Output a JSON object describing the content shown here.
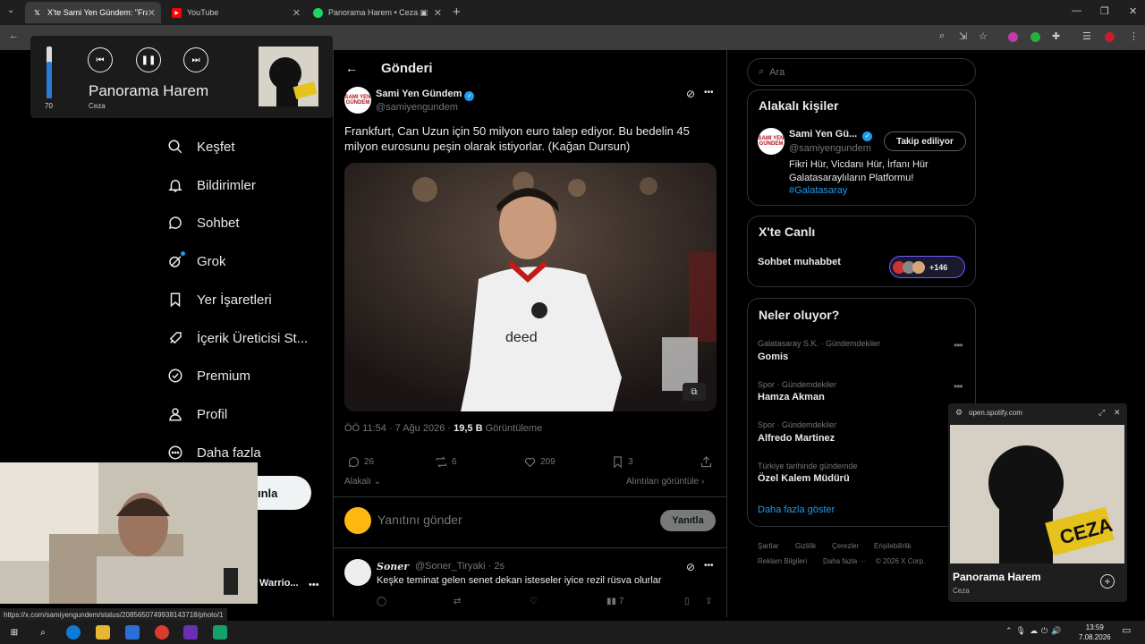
{
  "browser": {
    "tabs": [
      {
        "label": "X'te Sami Yen Gündem: \"Franki…",
        "active": true
      },
      {
        "label": "YouTube",
        "active": false
      },
      {
        "label": "Panorama Harem • Ceza",
        "active": false
      }
    ]
  },
  "media": {
    "volume": "70",
    "volume_level": 0.7,
    "title": "Panorama Harem",
    "artist": "Ceza"
  },
  "nav": {
    "items": [
      {
        "label": "Keşfet",
        "icon": "search-icon"
      },
      {
        "label": "Bildirimler",
        "icon": "bell-icon"
      },
      {
        "label": "Sohbet",
        "icon": "chat-icon"
      },
      {
        "label": "Grok",
        "icon": "grok-icon"
      },
      {
        "label": "Yer İşaretleri",
        "icon": "bookmark-icon"
      },
      {
        "label": "İçerik Üreticisi St...",
        "icon": "rocket-icon"
      },
      {
        "label": "Premium",
        "icon": "premium-icon"
      },
      {
        "label": "Profil",
        "icon": "person-icon"
      },
      {
        "label": "Daha fazla",
        "icon": "more-circle-icon"
      }
    ],
    "post_button_partial": "ınla",
    "account_partial": "Warrio..."
  },
  "post": {
    "header": "Gönderi",
    "author_name": "Sami Yen Gündem",
    "author_handle": "@samiyengundem",
    "text": "Frankfurt, Can Uzun için 50 milyon euro talep ediyor. Bu bedelin 45 milyon eurosunu peşin olarak istiyorlar. (Kağan Dursun)",
    "time": "ÖÖ 11:54 · 7 Ağu 2026 ·",
    "views": "19,5 B",
    "views_label": "Görüntüleme",
    "replies": "26",
    "reposts": "6",
    "likes": "209",
    "bookmarks": "3",
    "related": "Alakalı",
    "quotes": "Alıntıları görüntüle",
    "reply_placeholder": "Yanıtını gönder",
    "reply_button": "Yanıtla"
  },
  "comment": {
    "name": "Soner",
    "handle": "@Soner_Tiryaki · 2s",
    "text": "Keşke teminat gelen senet dekan isteseler iyice rezil rüsva olurlar",
    "views": "7"
  },
  "sidebar": {
    "search_placeholder": "Ara",
    "related_title": "Alakalı kişiler",
    "person": {
      "name": "Sami Yen Gü...",
      "handle": "@samiyengundem",
      "follow": "Takip ediliyor",
      "bio": "Fikri Hür, Vicdanı Hür, İrfanı Hür Galatasaraylıların Platformu!",
      "hashtag": "#Galatasaray"
    },
    "live_title": "X'te Canlı",
    "live_name": "Sohbet muhabbet",
    "live_count": "+146",
    "trends_title": "Neler oluyor?",
    "trends": [
      {
        "cat": "Galatasaray S.K. · Gündemdekiler",
        "name": "Gomis"
      },
      {
        "cat": "Spor · Gündemdekiler",
        "name": "Hamza Akman"
      },
      {
        "cat": "Spor · Gündemdekiler",
        "name": "Alfredo Martinez"
      },
      {
        "cat": "Türkiye tarihinde gündemde",
        "name": "Özel Kalem Müdürü"
      }
    ],
    "show_more": "Daha fazla göster",
    "footer": [
      "Şartlar",
      "Gizlilik",
      "Çerezler",
      "Erişilebilirlik",
      "Reklam Bilgileri",
      "Daha fazla ···",
      "© 2026 X Corp."
    ]
  },
  "spotify": {
    "url": "open.spotify.com",
    "title": "Panorama Harem",
    "artist": "Ceza"
  },
  "status_url": "https://x.com/samiyengundem/status/2085650749938143718/photo/1",
  "taskbar": {
    "time": "13:59",
    "date": "7.08.2026"
  }
}
